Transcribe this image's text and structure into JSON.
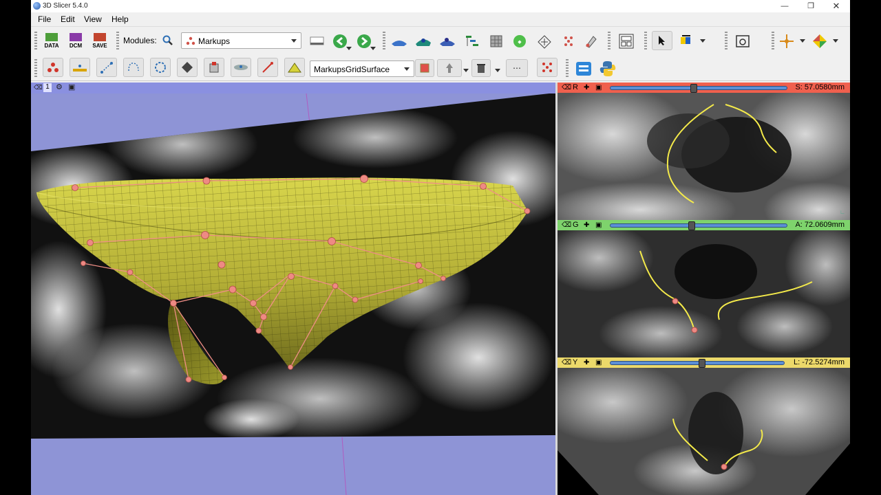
{
  "window": {
    "title": "3D Slicer 5.4.0"
  },
  "menu": [
    "File",
    "Edit",
    "View",
    "Help"
  ],
  "toolbar": {
    "data_label": "DATA",
    "dcm_label": "DCM",
    "save_label": "SAVE",
    "modules_label": "Modules:",
    "module_selected": "Markups"
  },
  "markups_toolbar": {
    "node_selected": "MarkupsGridSurface"
  },
  "view3d": {
    "label": "1"
  },
  "slices": [
    {
      "letter": "R",
      "value": "S: 57.0580mm",
      "color": "#f0604e",
      "slider_fraction": 0.47
    },
    {
      "letter": "G",
      "value": "A: 72.0609mm",
      "color": "#7ed36c",
      "slider_fraction": 0.46
    },
    {
      "letter": "Y",
      "value": "L: -72.5274mm",
      "color": "#ecd96a",
      "slider_fraction": 0.53
    }
  ],
  "colors": {
    "surface": "#b9b63e",
    "control_point": "#ee8a84",
    "curve": "#f4ea4a",
    "view_bg": "#8e94d6"
  }
}
